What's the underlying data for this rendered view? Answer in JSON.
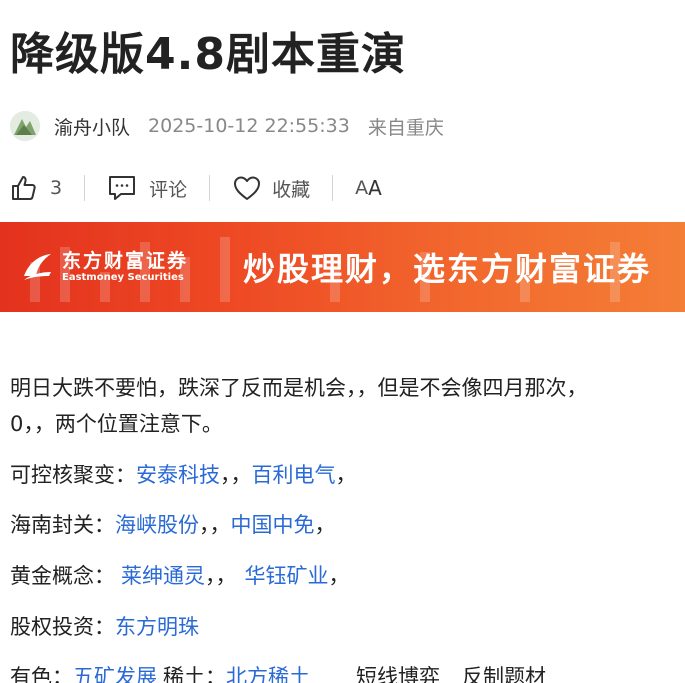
{
  "article": {
    "title": "降级版4.8剧本重演",
    "author": "渝舟小队",
    "time": "2025-10-12 22:55:33",
    "location": "来自重庆"
  },
  "actions": {
    "like_count": "3",
    "comment_label": "评论",
    "favorite_label": "收藏",
    "font_big": "A",
    "font_small": "A"
  },
  "banner": {
    "brand_cn": "东方财富证券",
    "brand_en": "Eastmoney Securities",
    "slogan": "炒股理财，选东方财富证券"
  },
  "body": {
    "para1_line1": "明日大跌不要怕，跌深了反而是机会，，但是不会像四月那次，",
    "para1_line2": "0，，两个位置注意下。",
    "rows": [
      {
        "label": "可控核聚变：",
        "items": [
          "安泰科技",
          "，，",
          "百利电气",
          "，"
        ]
      },
      {
        "label": "海南封关：",
        "items": [
          "海峡股份",
          "，，",
          "中国中免",
          "，"
        ]
      },
      {
        "label": "黄金概念：",
        "items": [
          "莱绅通灵",
          "，，",
          "华钰矿业",
          "，"
        ]
      },
      {
        "label": "股权投资：",
        "items": [
          "东方明珠"
        ]
      },
      {
        "label": "有色：",
        "items": [
          "五矿发展",
          "稀土：",
          "北方稀土",
          "短线博弈",
          "反制题材"
        ]
      }
    ]
  },
  "colors": {
    "link": "#2a6ad6",
    "banner_start": "#e3321e",
    "banner_end": "#f47e36"
  },
  "icons": [
    "thumbs-up-icon",
    "comment-icon",
    "heart-icon",
    "eastmoney-logo-icon"
  ]
}
